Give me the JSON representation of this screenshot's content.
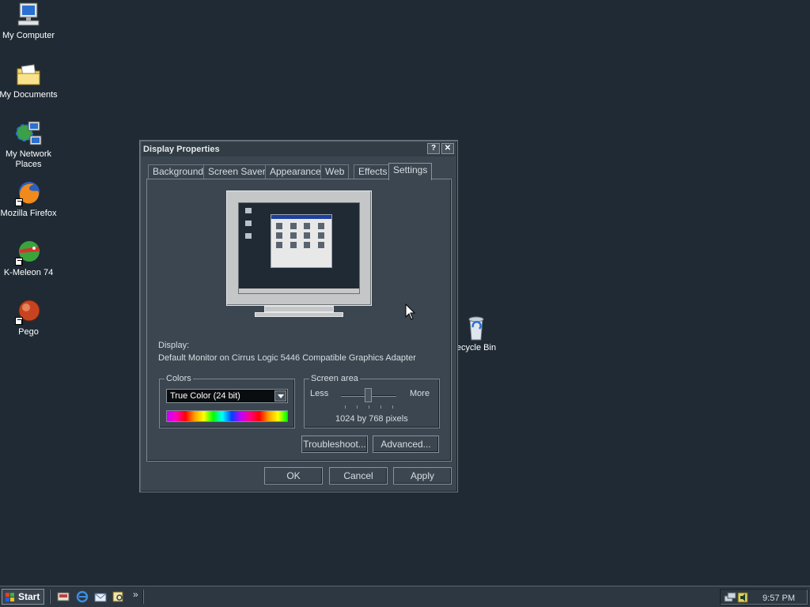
{
  "desktop": {
    "icons": [
      {
        "label": "My Computer",
        "icon": "computer-icon"
      },
      {
        "label": "My Documents",
        "icon": "folder-icon"
      },
      {
        "label": "My Network Places",
        "icon": "network-icon"
      },
      {
        "label": "Mozilla Firefox",
        "icon": "firefox-icon"
      },
      {
        "label": "K-Meleon 74",
        "icon": "kmeleon-icon"
      },
      {
        "label": "Pego",
        "icon": "pego-icon"
      }
    ],
    "recycle_bin": {
      "label": "ecycle Bin",
      "icon": "recycle-bin-icon"
    }
  },
  "dialog": {
    "title": "Display Properties",
    "help_button": "?",
    "close_button": "✕",
    "tabs": [
      "Background",
      "Screen Saver",
      "Appearance",
      "Web",
      "Effects",
      "Settings"
    ],
    "active_tab": "Settings",
    "display_label": "Display:",
    "display_value": "Default Monitor on Cirrus Logic 5446 Compatible Graphics Adapter",
    "colors": {
      "legend": "Colors",
      "selected": "True Color (24 bit)"
    },
    "screen_area": {
      "legend": "Screen area",
      "less": "Less",
      "more": "More",
      "resolution": "1024 by 768 pixels"
    },
    "buttons": {
      "troubleshoot": "Troubleshoot...",
      "advanced": "Advanced...",
      "ok": "OK",
      "cancel": "Cancel",
      "apply": "Apply"
    }
  },
  "taskbar": {
    "start_label": "Start",
    "quick_launch": [
      "show-desktop-icon",
      "ie-icon",
      "outlook-icon",
      "search-icon"
    ],
    "chevron": "»",
    "tray_icons": [
      "network-tray-icon",
      "volume-tray-icon"
    ],
    "clock": "9:57 PM"
  }
}
